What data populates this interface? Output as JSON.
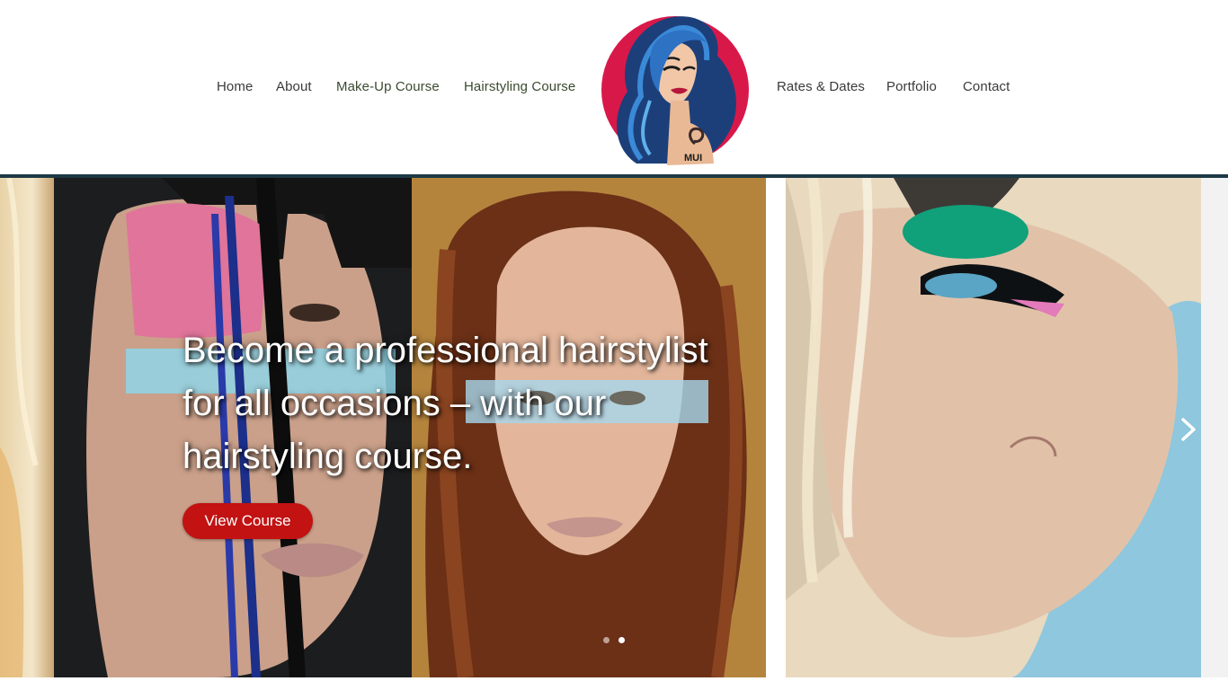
{
  "nav": {
    "left": [
      "Home",
      "About",
      "Make-Up Course",
      "Hairstyling Course"
    ],
    "right": [
      "Rates & Dates",
      "Portfolio",
      "Contact"
    ]
  },
  "logo": {
    "text": "MUI"
  },
  "hero": {
    "caption": "Become a professional hairstylist for all occasions – with our hairstyling course.",
    "button_label": "View Course",
    "slides_total": 2,
    "active_slide": 2
  },
  "colors": {
    "accent_button": "#c21212",
    "header_rule": "#1d3a45",
    "logo_circle": "#d9184a",
    "logo_hair": "#1f5fa8"
  },
  "icons": [
    "chevron-right-icon"
  ]
}
